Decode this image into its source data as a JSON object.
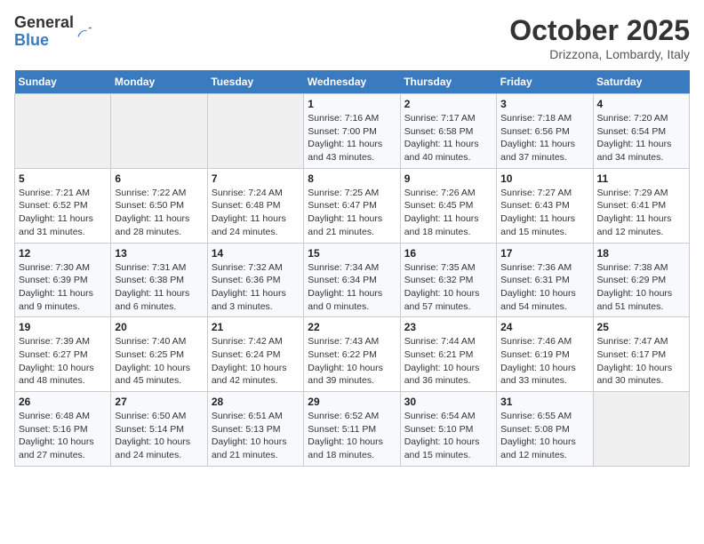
{
  "header": {
    "logo_general": "General",
    "logo_blue": "Blue",
    "month": "October 2025",
    "location": "Drizzona, Lombardy, Italy"
  },
  "days_of_week": [
    "Sunday",
    "Monday",
    "Tuesday",
    "Wednesday",
    "Thursday",
    "Friday",
    "Saturday"
  ],
  "weeks": [
    [
      {
        "day": "",
        "info": ""
      },
      {
        "day": "",
        "info": ""
      },
      {
        "day": "",
        "info": ""
      },
      {
        "day": "1",
        "info": "Sunrise: 7:16 AM\nSunset: 7:00 PM\nDaylight: 11 hours and 43 minutes."
      },
      {
        "day": "2",
        "info": "Sunrise: 7:17 AM\nSunset: 6:58 PM\nDaylight: 11 hours and 40 minutes."
      },
      {
        "day": "3",
        "info": "Sunrise: 7:18 AM\nSunset: 6:56 PM\nDaylight: 11 hours and 37 minutes."
      },
      {
        "day": "4",
        "info": "Sunrise: 7:20 AM\nSunset: 6:54 PM\nDaylight: 11 hours and 34 minutes."
      }
    ],
    [
      {
        "day": "5",
        "info": "Sunrise: 7:21 AM\nSunset: 6:52 PM\nDaylight: 11 hours and 31 minutes."
      },
      {
        "day": "6",
        "info": "Sunrise: 7:22 AM\nSunset: 6:50 PM\nDaylight: 11 hours and 28 minutes."
      },
      {
        "day": "7",
        "info": "Sunrise: 7:24 AM\nSunset: 6:48 PM\nDaylight: 11 hours and 24 minutes."
      },
      {
        "day": "8",
        "info": "Sunrise: 7:25 AM\nSunset: 6:47 PM\nDaylight: 11 hours and 21 minutes."
      },
      {
        "day": "9",
        "info": "Sunrise: 7:26 AM\nSunset: 6:45 PM\nDaylight: 11 hours and 18 minutes."
      },
      {
        "day": "10",
        "info": "Sunrise: 7:27 AM\nSunset: 6:43 PM\nDaylight: 11 hours and 15 minutes."
      },
      {
        "day": "11",
        "info": "Sunrise: 7:29 AM\nSunset: 6:41 PM\nDaylight: 11 hours and 12 minutes."
      }
    ],
    [
      {
        "day": "12",
        "info": "Sunrise: 7:30 AM\nSunset: 6:39 PM\nDaylight: 11 hours and 9 minutes."
      },
      {
        "day": "13",
        "info": "Sunrise: 7:31 AM\nSunset: 6:38 PM\nDaylight: 11 hours and 6 minutes."
      },
      {
        "day": "14",
        "info": "Sunrise: 7:32 AM\nSunset: 6:36 PM\nDaylight: 11 hours and 3 minutes."
      },
      {
        "day": "15",
        "info": "Sunrise: 7:34 AM\nSunset: 6:34 PM\nDaylight: 11 hours and 0 minutes."
      },
      {
        "day": "16",
        "info": "Sunrise: 7:35 AM\nSunset: 6:32 PM\nDaylight: 10 hours and 57 minutes."
      },
      {
        "day": "17",
        "info": "Sunrise: 7:36 AM\nSunset: 6:31 PM\nDaylight: 10 hours and 54 minutes."
      },
      {
        "day": "18",
        "info": "Sunrise: 7:38 AM\nSunset: 6:29 PM\nDaylight: 10 hours and 51 minutes."
      }
    ],
    [
      {
        "day": "19",
        "info": "Sunrise: 7:39 AM\nSunset: 6:27 PM\nDaylight: 10 hours and 48 minutes."
      },
      {
        "day": "20",
        "info": "Sunrise: 7:40 AM\nSunset: 6:25 PM\nDaylight: 10 hours and 45 minutes."
      },
      {
        "day": "21",
        "info": "Sunrise: 7:42 AM\nSunset: 6:24 PM\nDaylight: 10 hours and 42 minutes."
      },
      {
        "day": "22",
        "info": "Sunrise: 7:43 AM\nSunset: 6:22 PM\nDaylight: 10 hours and 39 minutes."
      },
      {
        "day": "23",
        "info": "Sunrise: 7:44 AM\nSunset: 6:21 PM\nDaylight: 10 hours and 36 minutes."
      },
      {
        "day": "24",
        "info": "Sunrise: 7:46 AM\nSunset: 6:19 PM\nDaylight: 10 hours and 33 minutes."
      },
      {
        "day": "25",
        "info": "Sunrise: 7:47 AM\nSunset: 6:17 PM\nDaylight: 10 hours and 30 minutes."
      }
    ],
    [
      {
        "day": "26",
        "info": "Sunrise: 6:48 AM\nSunset: 5:16 PM\nDaylight: 10 hours and 27 minutes."
      },
      {
        "day": "27",
        "info": "Sunrise: 6:50 AM\nSunset: 5:14 PM\nDaylight: 10 hours and 24 minutes."
      },
      {
        "day": "28",
        "info": "Sunrise: 6:51 AM\nSunset: 5:13 PM\nDaylight: 10 hours and 21 minutes."
      },
      {
        "day": "29",
        "info": "Sunrise: 6:52 AM\nSunset: 5:11 PM\nDaylight: 10 hours and 18 minutes."
      },
      {
        "day": "30",
        "info": "Sunrise: 6:54 AM\nSunset: 5:10 PM\nDaylight: 10 hours and 15 minutes."
      },
      {
        "day": "31",
        "info": "Sunrise: 6:55 AM\nSunset: 5:08 PM\nDaylight: 10 hours and 12 minutes."
      },
      {
        "day": "",
        "info": ""
      }
    ]
  ]
}
